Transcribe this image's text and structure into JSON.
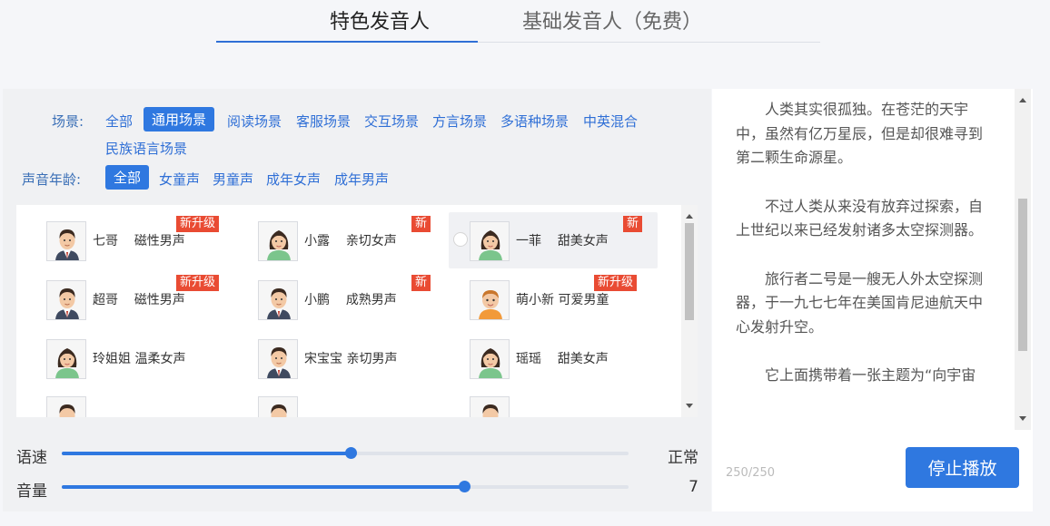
{
  "tabs": {
    "featured": "特色发音人",
    "basic": "基础发音人（免费）"
  },
  "filters": {
    "scene_label": "场景:",
    "scenes": [
      "全部",
      "通用场景",
      "阅读场景",
      "客服场景",
      "交互场景",
      "方言场景",
      "多语种场景",
      "中英混合",
      "民族语言场景"
    ],
    "scene_active": "通用场景",
    "age_label": "声音年龄:",
    "ages": [
      "全部",
      "女童声",
      "男童声",
      "成年女声",
      "成年男声"
    ],
    "age_active": "全部"
  },
  "voices": [
    {
      "name": "七哥",
      "style": "磁性男声",
      "badge": "新升级",
      "avatar": "male"
    },
    {
      "name": "小露",
      "style": "亲切女声",
      "badge": "新",
      "avatar": "female"
    },
    {
      "name": "一菲",
      "style": "甜美女声",
      "badge": "新",
      "avatar": "female",
      "selected": true
    },
    {
      "name": "超哥",
      "style": "磁性男声",
      "badge": "新升级",
      "avatar": "male"
    },
    {
      "name": "小鹏",
      "style": "成熟男声",
      "badge": "新",
      "avatar": "male"
    },
    {
      "name": "萌小新",
      "style": "可爱男童",
      "badge": "新升级",
      "avatar": "child"
    },
    {
      "name": "玲姐姐",
      "style": "温柔女声",
      "badge": "",
      "avatar": "female"
    },
    {
      "name": "宋宝宝",
      "style": "亲切男声",
      "badge": "",
      "avatar": "male"
    },
    {
      "name": "瑶瑶",
      "style": "甜美女声",
      "badge": "",
      "avatar": "female"
    }
  ],
  "voice_list_scroll": {
    "position": 0.0,
    "visible_fraction": 0.55
  },
  "sliders": {
    "speed": {
      "label": "语速",
      "value_text": "正常",
      "level": 0.51
    },
    "volume": {
      "label": "音量",
      "value_text": "7",
      "level": 0.71
    }
  },
  "text": {
    "paragraphs": [
      "人类其实很孤独。在苍茫的天宇中，虽然有亿万星辰，但是却很难寻到第二颗生命源星。",
      "不过人类从来没有放弃过探索，自上世纪以来已经发射诸多太空探测器。",
      "旅行者二号是一艘无人外太空探测器，于一九七七年在美国肯尼迪航天中心发射升空。",
      "它上面携带着一张主题为“向宇宙"
    ],
    "char_count": "250/250",
    "scroll": {
      "position": 0.6,
      "visible_fraction": 0.5
    }
  },
  "actions": {
    "stop_label": "停止播放"
  },
  "colors": {
    "accent": "#2f78e0",
    "badge": "#e94b33",
    "label": "#3a6fb6"
  }
}
